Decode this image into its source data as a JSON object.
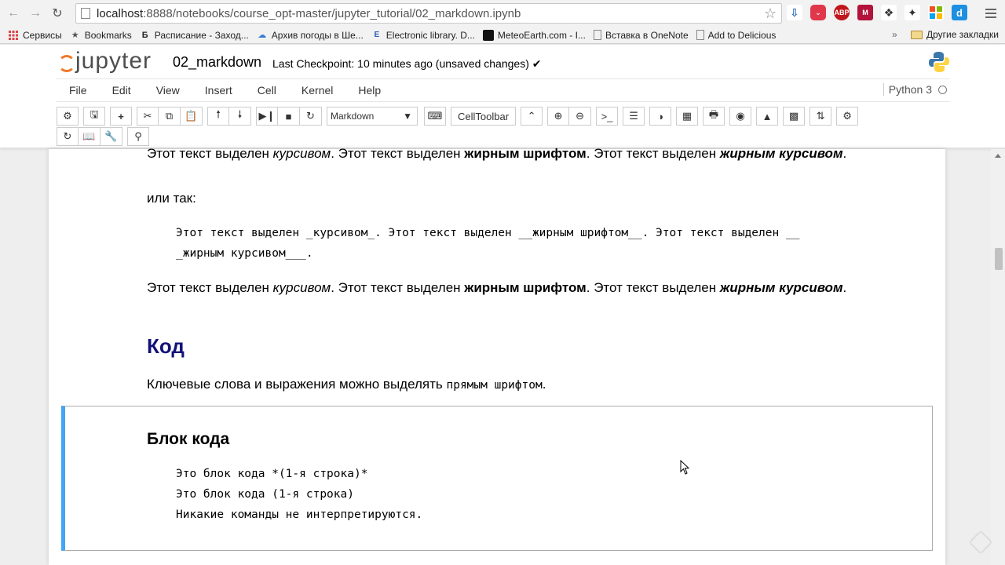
{
  "browser": {
    "url_host": "localhost",
    "url_path": ":8888/notebooks/course_opt-master/jupyter_tutorial/02_markdown.ipynb",
    "bookmarks": [
      {
        "label": "Сервисы",
        "icon": "apps-grid-icon"
      },
      {
        "label": "Bookmarks",
        "icon": "star-icon"
      },
      {
        "label": "Расписание - Заход...",
        "icon": "b-icon"
      },
      {
        "label": "Архив погоды в Ше...",
        "icon": "weather-icon"
      },
      {
        "label": "Electronic library. D...",
        "icon": "library-icon"
      },
      {
        "label": "MeteoEarth.com - I...",
        "icon": "meteo-icon"
      },
      {
        "label": "Вставка в OneNote",
        "icon": "page-icon"
      },
      {
        "label": "Add to Delicious",
        "icon": "page-icon"
      }
    ],
    "bookmarks_more": "»",
    "other_bookmarks": "Другие закладки",
    "ext_labels": [
      "",
      "",
      "ABP",
      "",
      "",
      "",
      "",
      "d"
    ]
  },
  "jupyter": {
    "logo_text": "jupyter",
    "notebook_name": "02_markdown",
    "checkpoint": "Last Checkpoint: 10 minutes ago (unsaved changes) ✔",
    "menu": [
      "File",
      "Edit",
      "View",
      "Insert",
      "Cell",
      "Kernel",
      "Help"
    ],
    "kernel": "Python 3",
    "cell_type": "Markdown",
    "celltoolbar_label": "CellToolbar"
  },
  "content": {
    "line1_a": "Этот текст выделен ",
    "line1_it": "курсивом",
    "line1_b": ". Этот текст выделен ",
    "line1_bold": "жирным шрифтом",
    "line1_c": ". Этот текст выделен ",
    "line1_bi": "жирным курсивом",
    "line1_d": ".",
    "ili_tak": "или так:",
    "raw1": "Этот текст выделен _курсивом_. Этот текст выделен __жирным шрифтом__. Этот текст выделен __",
    "raw2": "_жирным курсивом___.",
    "heading_code": "Код",
    "keywords_a": "Ключевые слова и выражения можно выделять ",
    "keywords_mono": "прямым шрифтом",
    "keywords_b": ".",
    "heading_block": "Блок кода",
    "code1": "Это блок кода *(1-я строка)*",
    "code2": "Это блок кода (1-я строка)",
    "code3": "Никакие команды не интерпретируются."
  }
}
